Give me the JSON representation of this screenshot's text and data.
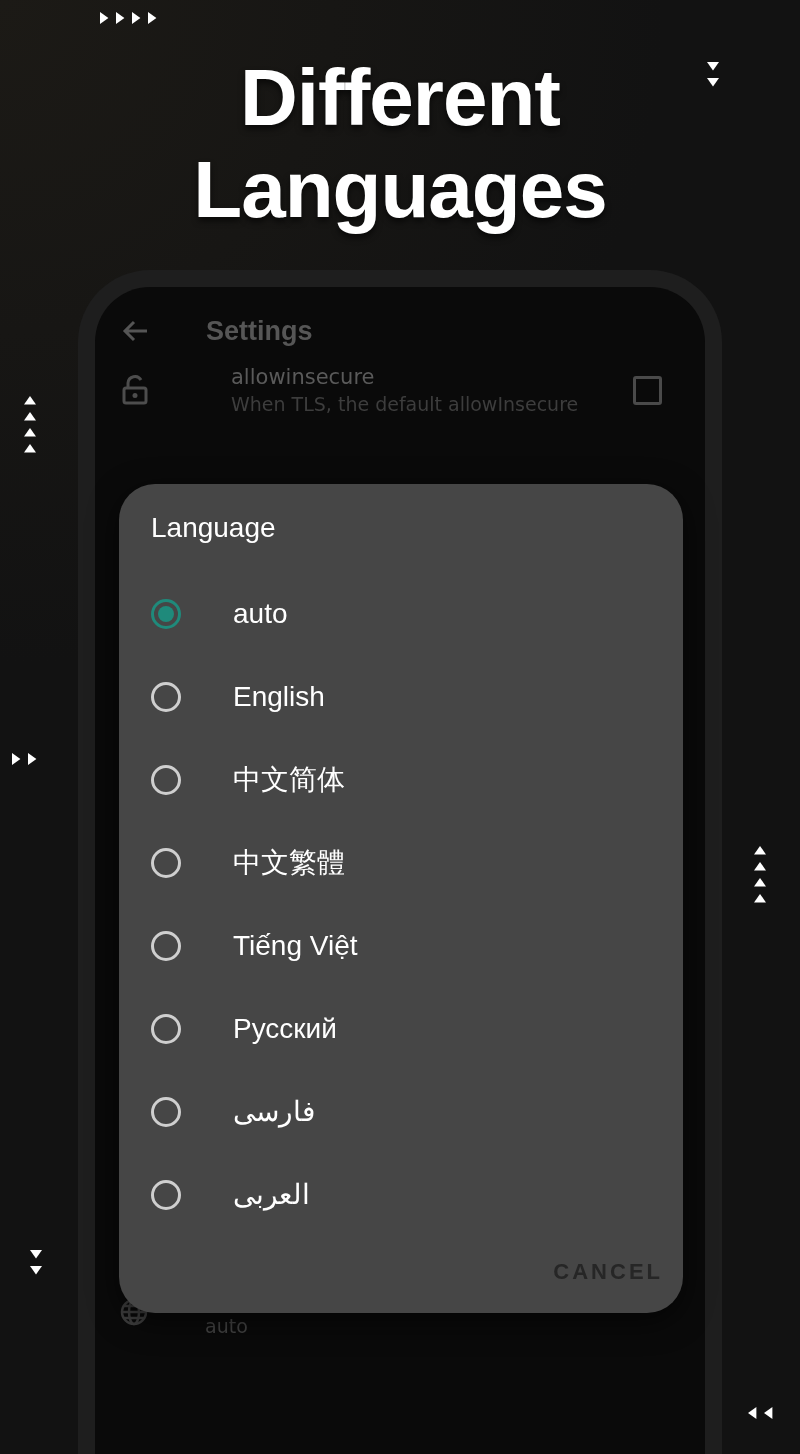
{
  "headline": [
    "Different",
    "Languages"
  ],
  "screen": {
    "title": "Settings",
    "setting": {
      "title": "allowinsecure",
      "subtitle": "When TLS, the default allowInsecure",
      "checked": false
    },
    "language_setting": {
      "value": "auto"
    }
  },
  "dialog": {
    "title": "Language",
    "options": [
      {
        "label": "auto",
        "selected": true
      },
      {
        "label": "English",
        "selected": false
      },
      {
        "label": "中文简体",
        "selected": false
      },
      {
        "label": "中文繁體",
        "selected": false
      },
      {
        "label": "Tiếng Việt",
        "selected": false
      },
      {
        "label": "Русский",
        "selected": false
      },
      {
        "label": "فارسی",
        "selected": false
      },
      {
        "label": "العربی",
        "selected": false
      }
    ],
    "cancel": "CANCEL"
  }
}
